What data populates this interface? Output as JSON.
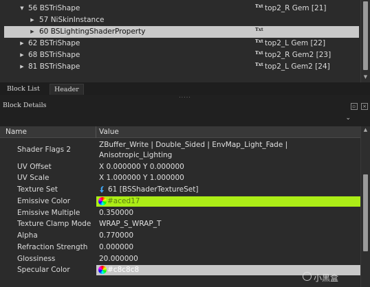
{
  "block_list": {
    "rows": [
      {
        "label": "56 BSTriShape",
        "arrow": "▼",
        "material": "top2_R Gem [21]",
        "material_icon": "Txt"
      },
      {
        "label": "57 NiSkinInstance",
        "arrow": "▶",
        "material": "",
        "material_icon": ""
      },
      {
        "label": "60 BSLightingShaderProperty",
        "arrow": "▶",
        "material": "",
        "material_icon": "Txt"
      },
      {
        "label": "62 BSTriShape",
        "arrow": "▶",
        "material": "top2_L Gem [22]",
        "material_icon": "Txt"
      },
      {
        "label": "68 BSTriShape",
        "arrow": "▶",
        "material": "top2_R Gem2 [23]",
        "material_icon": "Txt"
      },
      {
        "label": "81 BSTriShape",
        "arrow": "▶",
        "material": "top2_L Gem2 [24]",
        "material_icon": "Txt"
      }
    ]
  },
  "tabs": {
    "block_list": "Block List",
    "header": "Header"
  },
  "splitter_handle": ".....",
  "details": {
    "title": "Block Details",
    "collapse_icon": "⌄",
    "columns": {
      "name": "Name",
      "value": "Value"
    },
    "rows": [
      {
        "name": "Shader Flags 2",
        "value": "ZBuffer_Write | Double_Sided | EnvMap_Light_Fade | Anisotropic_Lighting"
      },
      {
        "name": "UV Offset",
        "value": "X 0.000000 Y 0.000000"
      },
      {
        "name": "UV Scale",
        "value": "X 1.000000 Y 1.000000"
      },
      {
        "name": "Texture Set",
        "value": "61 [BSShaderTextureSet]"
      },
      {
        "name": "Emissive Color",
        "value": "#aced17"
      },
      {
        "name": "Emissive Multiple",
        "value": "0.350000"
      },
      {
        "name": "Texture Clamp Mode",
        "value": "WRAP_S_WRAP_T"
      },
      {
        "name": "Alpha",
        "value": "0.770000"
      },
      {
        "name": "Refraction Strength",
        "value": "0.000000"
      },
      {
        "name": "Glossiness",
        "value": "20.000000"
      },
      {
        "name": "Specular Color",
        "value": "#c8c8c8"
      }
    ]
  },
  "watermark": "小黑盒",
  "colors": {
    "emissive": "#aced17",
    "specular": "#c8c8c8",
    "selection": "#c9c9c9",
    "panel": "#2b2b2b"
  }
}
